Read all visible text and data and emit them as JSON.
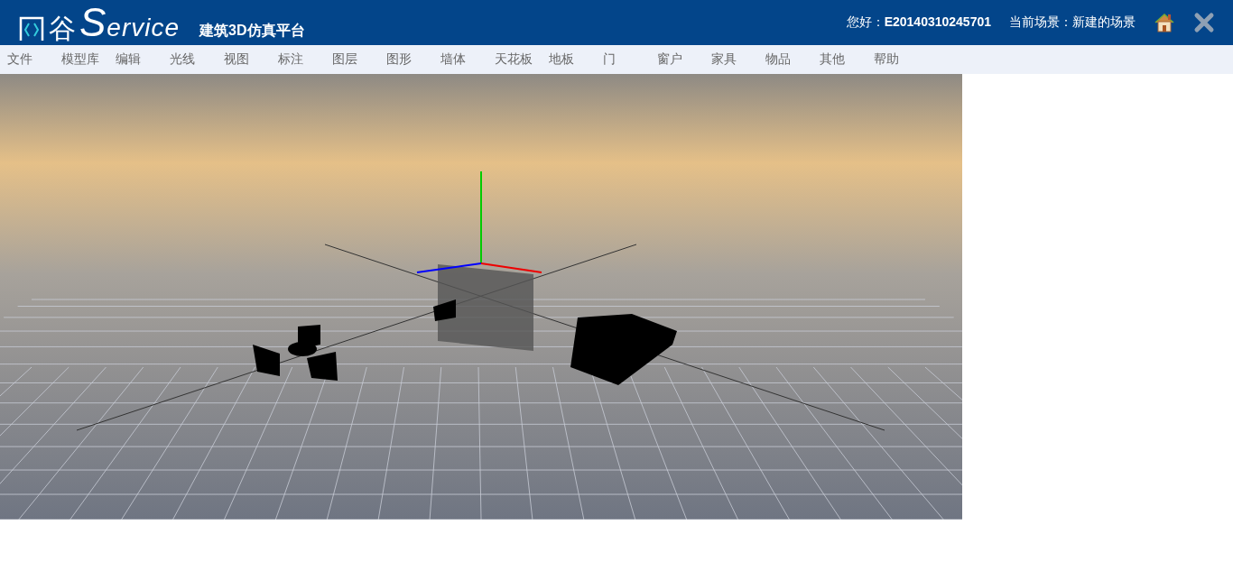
{
  "header": {
    "logo_char": "谷",
    "logo_word": "Service",
    "subtitle": "建筑3D仿真平台",
    "greeting_label": "您好：",
    "user_id": "E20140310245701",
    "scene_label": "当前场景：新建的场景"
  },
  "menu": [
    "文件",
    "模型库",
    "编辑",
    "光线",
    "视图",
    "标注",
    "图层",
    "图形",
    "墙体",
    "天花板",
    "地板",
    "门",
    "窗户",
    "家具",
    "物品",
    "其他",
    "帮助"
  ]
}
